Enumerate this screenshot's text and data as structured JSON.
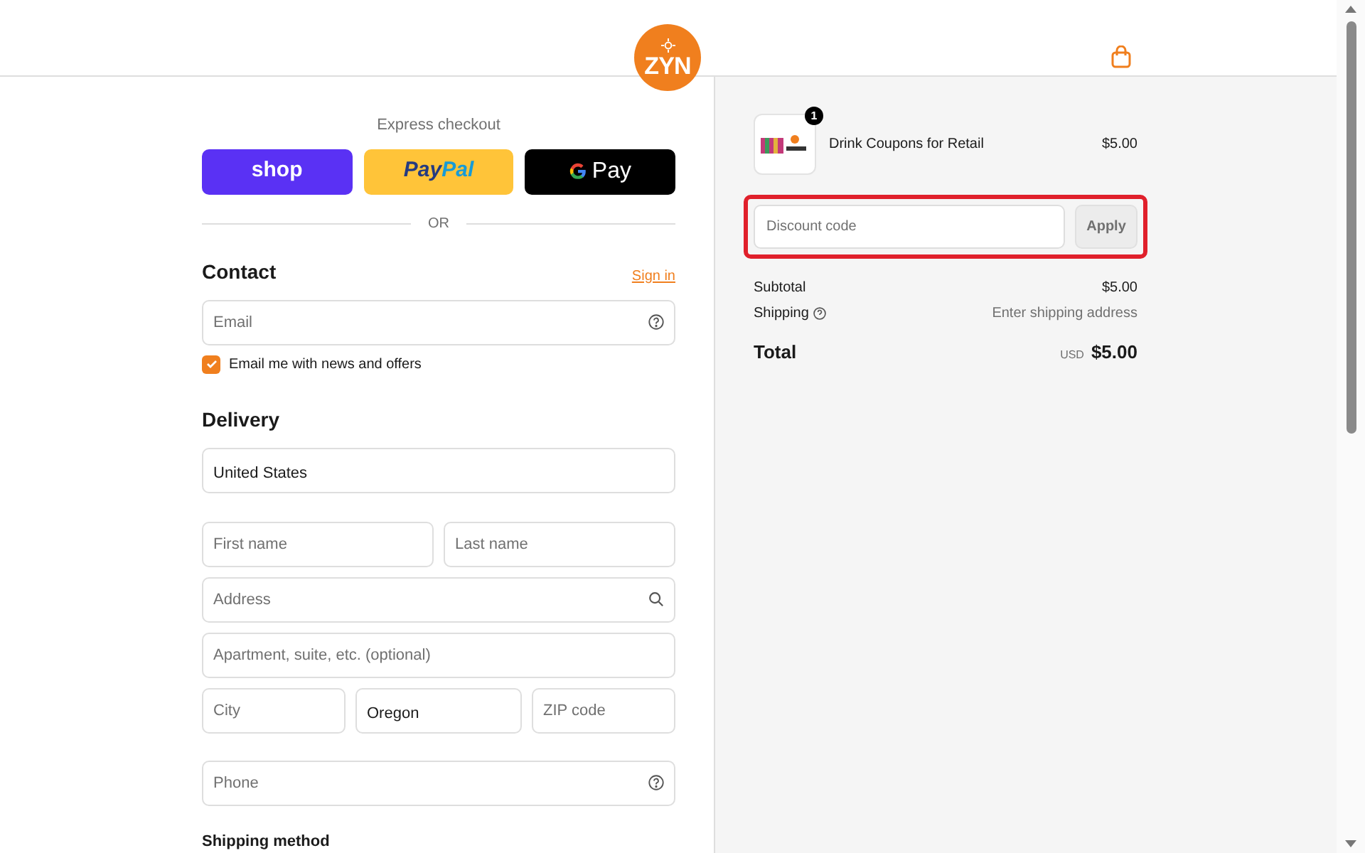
{
  "header": {
    "logo_text": "ZYN"
  },
  "express_checkout": {
    "title": "Express checkout",
    "buttons": [
      {
        "kind": "shop",
        "label": "shop"
      },
      {
        "kind": "paypal",
        "label": "Pay",
        "label_2": "Pal"
      },
      {
        "kind": "gpay",
        "label": "Pay"
      }
    ],
    "divider": "OR"
  },
  "contact": {
    "title": "Contact",
    "link": "Sign in",
    "email": {
      "kind": "help",
      "placeholder": "Email"
    },
    "newsletter": {
      "label": "Email me with news and offers",
      "checked": true
    }
  },
  "delivery": {
    "title": "Delivery",
    "rows": [
      [
        {
          "kind": "select",
          "value": "United States"
        }
      ],
      [
        {
          "kind": "text",
          "placeholder": "First name"
        },
        {
          "kind": "text",
          "placeholder": "Last name"
        }
      ],
      [
        {
          "kind": "search",
          "placeholder": "Address"
        }
      ],
      [
        {
          "kind": "text",
          "placeholder": "Apartment, suite, etc. (optional)"
        }
      ],
      [
        {
          "kind": "text",
          "placeholder": "City"
        },
        {
          "kind": "select",
          "value": "Oregon"
        },
        {
          "kind": "text",
          "placeholder": "ZIP code"
        }
      ],
      [
        {
          "kind": "help",
          "placeholder": "Phone"
        }
      ]
    ]
  },
  "shipping_method": {
    "title": "Shipping method"
  },
  "order_summary": {
    "items": [
      {
        "name": "Drink Coupons for Retail",
        "quantity": "1",
        "price": "$5.00"
      }
    ],
    "discount": {
      "placeholder": "Discount code",
      "button": "Apply",
      "highlighted": true
    },
    "subtotal": {
      "label": "Subtotal",
      "value": "$5.00"
    },
    "shipping": {
      "label": "Shipping",
      "value": "Enter shipping address"
    },
    "total": {
      "label": "Total",
      "currency": "USD",
      "value": "$5.00"
    }
  }
}
